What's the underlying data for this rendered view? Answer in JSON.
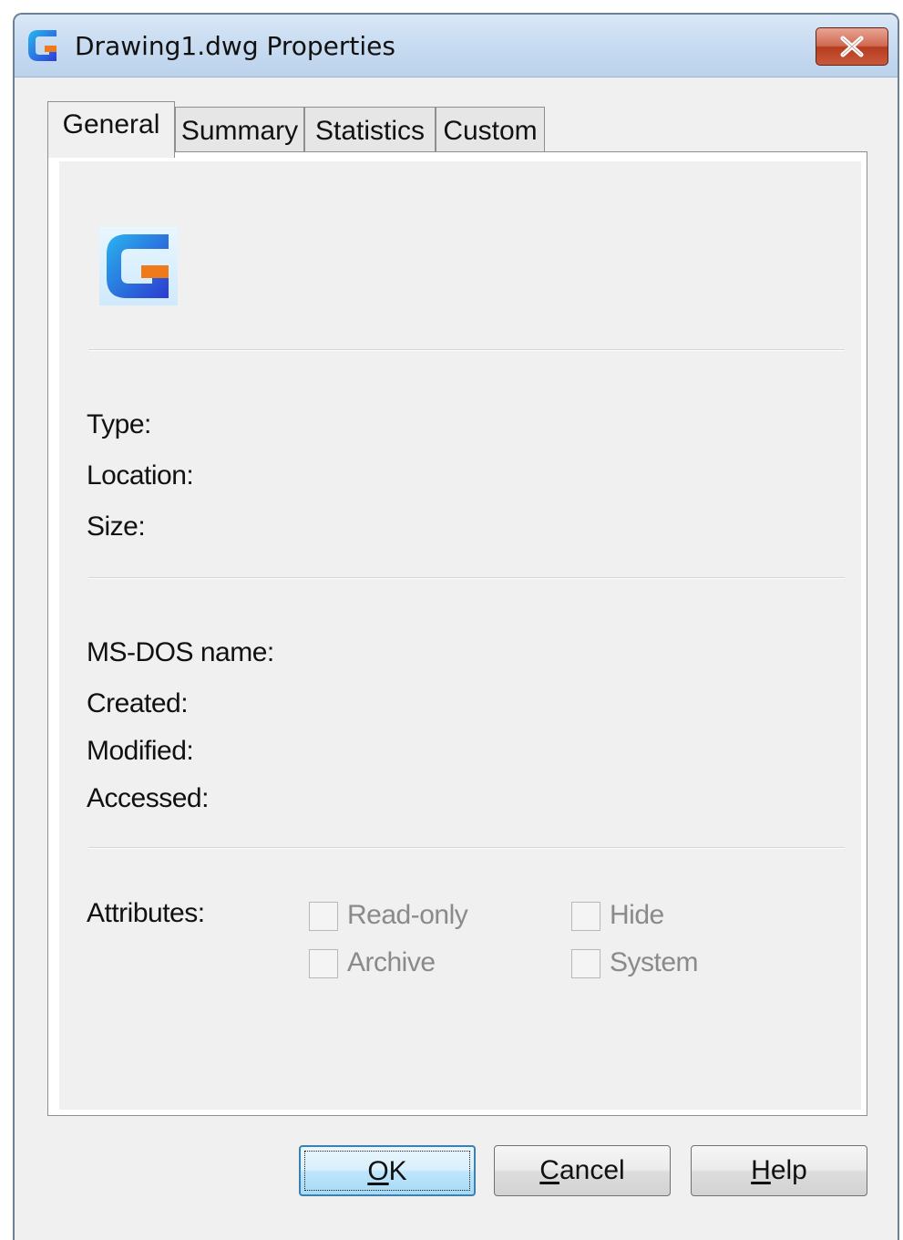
{
  "window": {
    "title": "Drawing1.dwg Properties"
  },
  "tabs": [
    {
      "label": "General",
      "active": true
    },
    {
      "label": "Summary",
      "active": false
    },
    {
      "label": "Statistics",
      "active": false
    },
    {
      "label": "Custom",
      "active": false
    }
  ],
  "general": {
    "type_label": "Type:",
    "location_label": "Location:",
    "size_label": "Size:",
    "msdos_label": "MS-DOS name:",
    "created_label": "Created:",
    "modified_label": "Modified:",
    "accessed_label": "Accessed:",
    "attributes_label": "Attributes:",
    "attributes": {
      "readonly": {
        "label": "Read-only",
        "checked": false,
        "enabled": false
      },
      "hide": {
        "label": "Hide",
        "checked": false,
        "enabled": false
      },
      "archive": {
        "label": "Archive",
        "checked": false,
        "enabled": false
      },
      "system": {
        "label": "System",
        "checked": false,
        "enabled": false
      }
    }
  },
  "buttons": {
    "ok": {
      "label": "OK",
      "mnemonic": "O"
    },
    "cancel": {
      "label": "Cancel",
      "mnemonic": "C"
    },
    "help": {
      "label": "Help",
      "mnemonic": "H"
    }
  },
  "icons": {
    "app": "app-logo-icon",
    "file": "dwg-file-icon",
    "close": "close-icon"
  },
  "colors": {
    "accent_blue": "#2a6fe0",
    "accent_orange": "#f07a1a",
    "close_red": "#c9583a"
  }
}
